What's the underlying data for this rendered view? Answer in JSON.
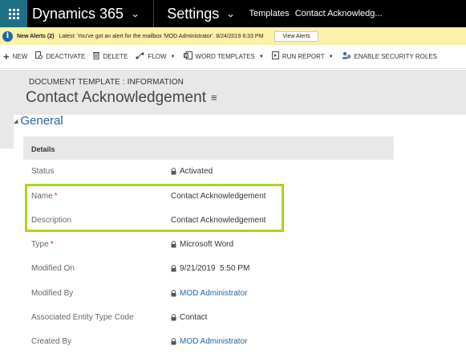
{
  "nav": {
    "app_title": "Dynamics 365",
    "area_title": "Settings",
    "breadcrumb_1": "Templates",
    "breadcrumb_2": "Contact Acknowledg..."
  },
  "alert": {
    "title": "New Alerts (2)",
    "message": "Latest: You've got an alert for the mailbox 'MOD Administrator'. 8/24/2019 6:33 PM",
    "button": "View Alerts"
  },
  "commands": [
    {
      "label": "NEW",
      "icon": "plus-icon"
    },
    {
      "label": "DEACTIVATE",
      "icon": "deactivate-icon"
    },
    {
      "label": "DELETE",
      "icon": "trash-icon"
    },
    {
      "label": "FLOW",
      "icon": "flow-icon"
    },
    {
      "label": "WORD TEMPLATES",
      "icon": "word-icon"
    },
    {
      "label": "RUN REPORT",
      "icon": "report-icon"
    },
    {
      "label": "ENABLE SECURITY ROLES",
      "icon": "security-icon"
    }
  ],
  "header": {
    "entity_label": "DOCUMENT TEMPLATE : INFORMATION",
    "record_title": "Contact Acknowledgement"
  },
  "section": {
    "title": "General",
    "subtitle": "Details"
  },
  "fields": [
    {
      "label": "Status",
      "value": "Activated",
      "locked": true,
      "required": false,
      "link": false
    },
    {
      "label": "Name",
      "value": "Contact Acknowledgement",
      "locked": false,
      "required": true,
      "link": false
    },
    {
      "label": "Description",
      "value": "Contact Acknowledgement",
      "locked": false,
      "required": false,
      "link": false
    },
    {
      "label": "Type",
      "value": "Microsoft Word",
      "locked": true,
      "required": true,
      "link": false
    },
    {
      "label": "Modified On",
      "value": "9/21/2019  5:50 PM",
      "locked": true,
      "required": false,
      "link": false
    },
    {
      "label": "Modified By",
      "value": "MOD Administrator",
      "locked": true,
      "required": false,
      "link": true
    },
    {
      "label": "Associated Entity Type Code",
      "value": "Contact",
      "locked": true,
      "required": false,
      "link": false
    },
    {
      "label": "Created By",
      "value": "MOD Administrator",
      "locked": true,
      "required": false,
      "link": true
    }
  ],
  "colors": {
    "topbar": "#000000",
    "waffle": "#1e6f86",
    "alert_bg": "#fbf1a9",
    "link": "#2266a8",
    "highlight": "#a9d51f",
    "required": "#c42a2a"
  },
  "required_marker": "*"
}
